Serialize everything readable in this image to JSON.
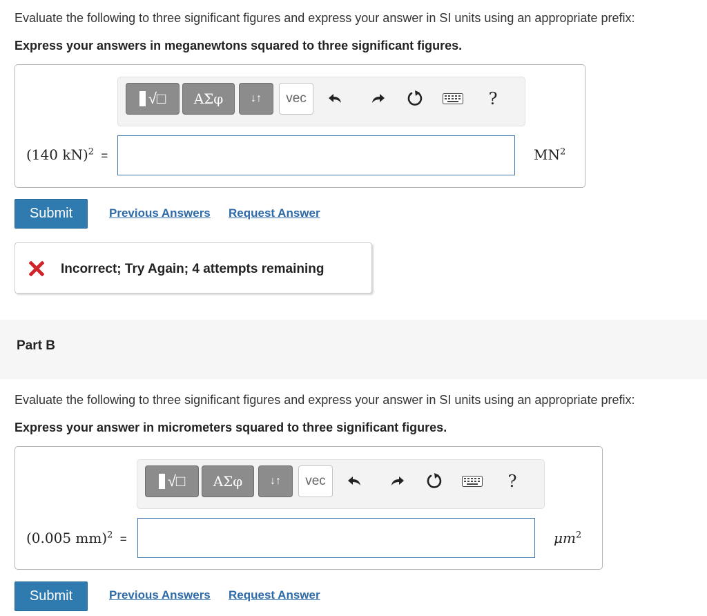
{
  "partA": {
    "prompt": "Evaluate the following to three significant figures and express your answer in SI units using an appropriate prefix:",
    "instruction": "Express your answers in meganewtons squared to three significant figures.",
    "toolbar": {
      "templates_glyph": "√□",
      "greek_label": "ΑΣφ",
      "arrows_label": "↓↑",
      "vec_label": "vec",
      "help_label": "?"
    },
    "expression": "(140 kN)",
    "exponent": "2",
    "equals": "=",
    "input_value": "",
    "unit": "MN",
    "unit_exponent": "2",
    "submit_label": "Submit",
    "previous_answers_label": "Previous Answers",
    "request_answer_label": "Request Answer",
    "feedback": {
      "text": "Incorrect; Try Again; 4 attempts remaining",
      "icon_color": "#d0262b"
    }
  },
  "partB": {
    "header": "Part B",
    "prompt": "Evaluate the following to three significant figures and express your answer in SI units using an appropriate prefix:",
    "instruction": "Express your answer in micrometers squared to three significant figures.",
    "toolbar": {
      "templates_glyph": "√□",
      "greek_label": "ΑΣφ",
      "arrows_label": "↓↑",
      "vec_label": "vec",
      "help_label": "?"
    },
    "expression": "(0.005 mm)",
    "exponent": "2",
    "equals": "=",
    "input_value": "",
    "unit": "μm",
    "unit_exponent": "2",
    "submit_label": "Submit",
    "previous_answers_label": "Previous Answers",
    "request_answer_label": "Request Answer"
  },
  "colors": {
    "submit": "#2f7bb0",
    "link": "#2e6aa8",
    "input_border": "#3f77b1",
    "error": "#d0262b"
  }
}
